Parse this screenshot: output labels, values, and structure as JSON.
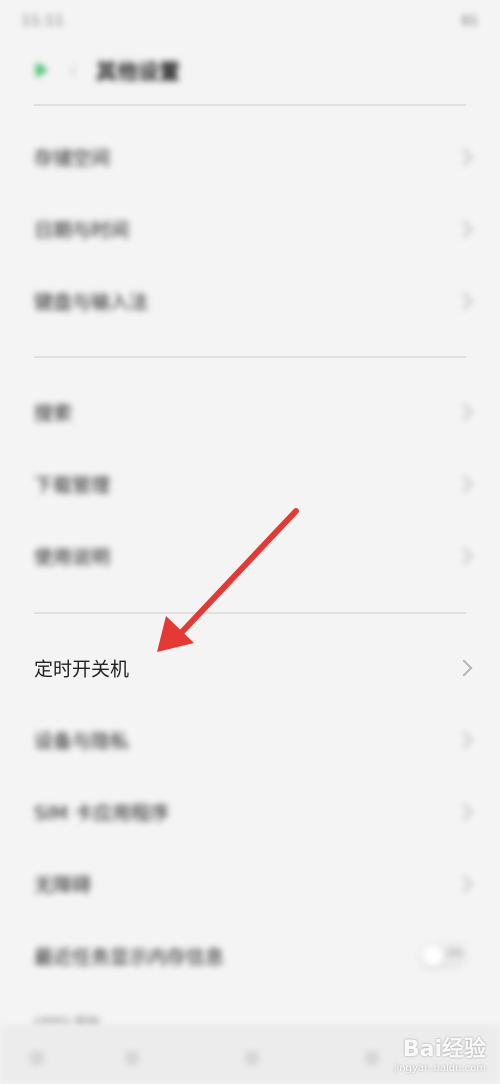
{
  "status_bar": {
    "time": "11:11",
    "battery": "61"
  },
  "header": {
    "title": "其他设置"
  },
  "sections": [
    {
      "items": [
        {
          "label": "存储空间"
        },
        {
          "label": "日期与时间"
        },
        {
          "label": "键盘与输入法"
        }
      ]
    },
    {
      "items": [
        {
          "label": "搜索"
        },
        {
          "label": "下载管理"
        },
        {
          "label": "使用说明"
        }
      ]
    },
    {
      "items": [
        {
          "label": "定时开关机"
        },
        {
          "label": "设备与隐私"
        },
        {
          "label": "SIM 卡应用程序"
        },
        {
          "label": "无障碍"
        },
        {
          "label": "最近任务显示内存信息",
          "toggle_text": "ON"
        }
      ]
    }
  ],
  "footer": {
    "label": "OPPO 帮助"
  },
  "watermark": {
    "main": "Bai经验",
    "sub": "jingyan.baidu.com"
  },
  "colors": {
    "arrow": "#e53935",
    "back_icon": "#3fbf6a"
  }
}
